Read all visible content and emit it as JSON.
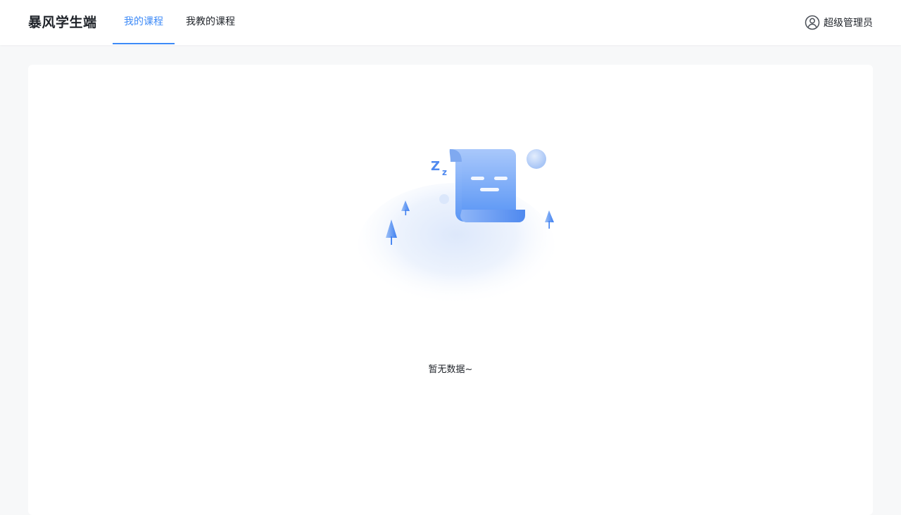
{
  "app": {
    "brand": "暴风学生端"
  },
  "nav": {
    "tabs": [
      {
        "label": "我的课程",
        "active": true
      },
      {
        "label": "我教的课程",
        "active": false
      }
    ]
  },
  "user": {
    "name": "超级管理员",
    "icon": "user-circle-icon"
  },
  "empty": {
    "text": "暂无数据~",
    "icon": "empty-scroll-illustration",
    "sleep_mark": "Z z"
  },
  "colors": {
    "accent": "#3d8af7",
    "text": "#1f2329",
    "background": "#f7f8f9",
    "card": "#ffffff"
  }
}
